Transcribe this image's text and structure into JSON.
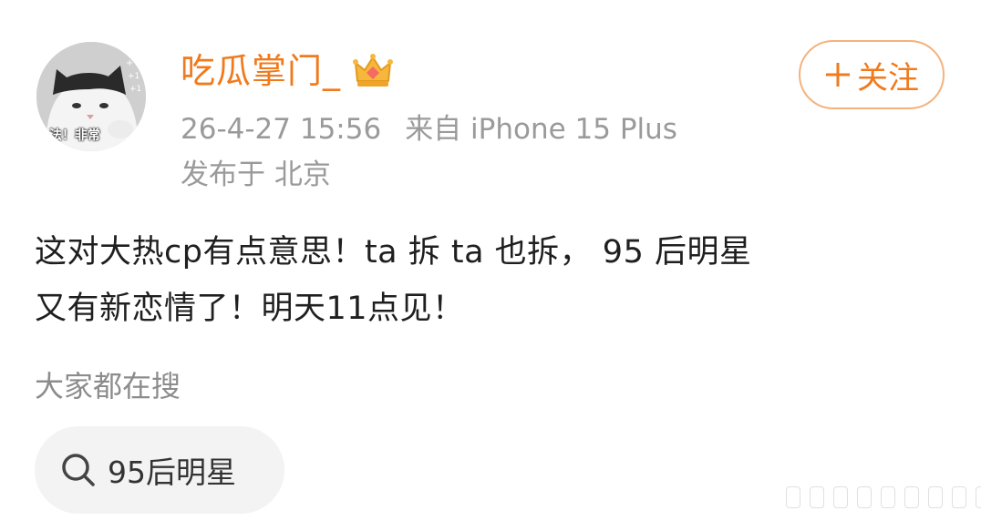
{
  "user": {
    "avatar_icon": "cat-avatar-icon",
    "avatar_caption": "法！非常",
    "name": "吃瓜掌门_",
    "badge_icon": "crown-icon",
    "follow_button_icon": "plus-icon",
    "follow_button_label": "关注"
  },
  "meta": {
    "time": "26-4-27 15:56",
    "source": "来自 iPhone 15 Plus",
    "location": "发布于 北京"
  },
  "post": {
    "line1": "这对大热cp有点意思！ta 拆 ta 也拆， 95 后明星",
    "line2": "又有新恋情了！明天11点见！"
  },
  "search": {
    "header": "大家都在搜",
    "chip_icon": "search-icon",
    "chip_label": "95后明星"
  },
  "colors": {
    "accent": "#f07a1c",
    "meta_text": "#9a9a9a",
    "body_text": "#1f1f1f",
    "chip_bg": "#f3f3f3"
  }
}
